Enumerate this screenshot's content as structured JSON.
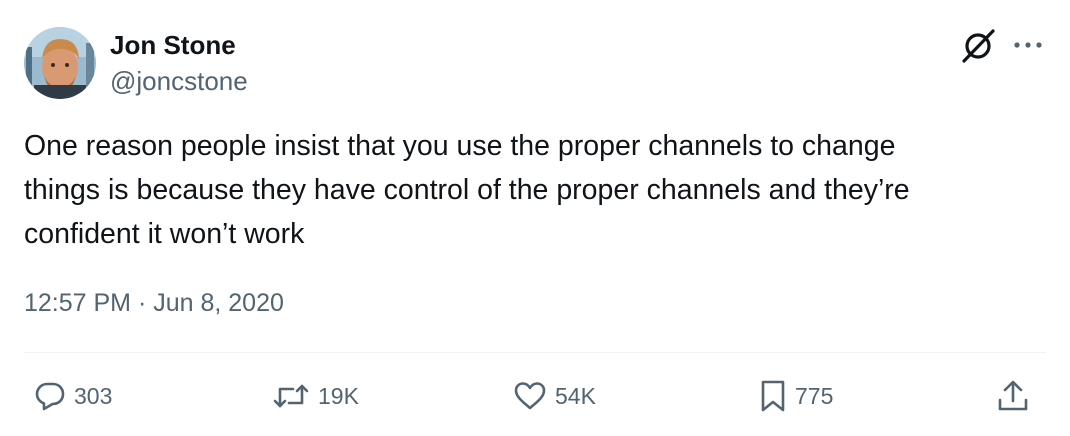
{
  "author": {
    "name": "Jon Stone",
    "handle": "@joncstone"
  },
  "tweet": {
    "text": "One reason people insist that you use the proper channels to change\nthings is because they have control of the proper channels and they’re\nconfident it won’t work",
    "timestamp": "12:57 PM · Jun 8, 2020"
  },
  "actions": {
    "replies": "303",
    "retweets": "19K",
    "likes": "54K",
    "bookmarks": "775"
  },
  "icons": {
    "header": [
      "avatar",
      "logo-mark-icon",
      "more-icon"
    ],
    "actions": [
      "reply-icon",
      "retweet-icon",
      "like-icon",
      "bookmark-icon",
      "share-icon"
    ]
  },
  "colors": {
    "text": "#0f1419",
    "secondary": "#536471",
    "divider": "#eff3f4"
  }
}
